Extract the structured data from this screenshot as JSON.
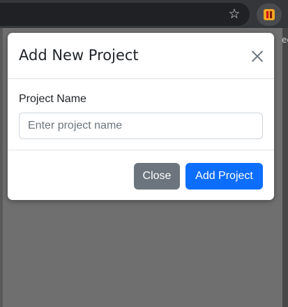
{
  "browser": {
    "star_glyph": "☆",
    "edge_text": "ec"
  },
  "modal": {
    "title": "Add New Project",
    "field_label": "Project Name",
    "input_value": "",
    "input_placeholder": "Enter project name",
    "close_label": "Close",
    "submit_label": "Add Project"
  },
  "colors": {
    "primary": "#0d6efd",
    "secondary": "#6c757d",
    "backdrop": "#6f6f6f",
    "chrome": "#35363a"
  },
  "icons": [
    "star-icon",
    "extension-icon",
    "close-icon"
  ]
}
